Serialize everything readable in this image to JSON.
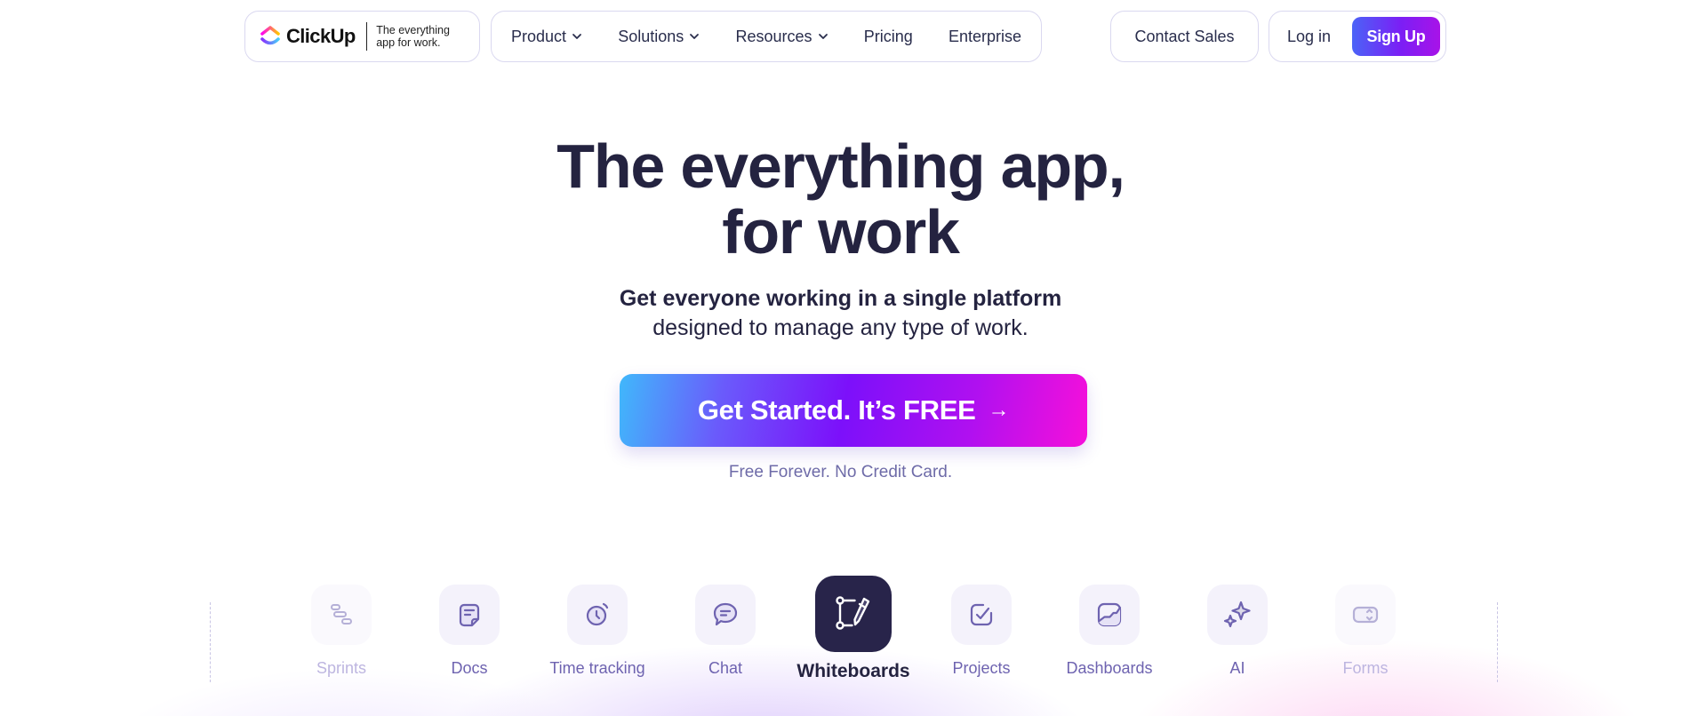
{
  "header": {
    "brand": {
      "name": "ClickUp",
      "tagline_line1": "The everything",
      "tagline_line2": "app for work."
    },
    "nav": [
      {
        "label": "Product",
        "has_dropdown": true
      },
      {
        "label": "Solutions",
        "has_dropdown": true
      },
      {
        "label": "Resources",
        "has_dropdown": true
      },
      {
        "label": "Pricing",
        "has_dropdown": false
      },
      {
        "label": "Enterprise",
        "has_dropdown": false
      }
    ],
    "contact_sales": "Contact Sales",
    "login": "Log in",
    "signup": "Sign Up"
  },
  "hero": {
    "title_line1": "The everything app,",
    "title_line2": "for work",
    "subtitle_bold": "Get everyone working in a single platform",
    "subtitle_regular": "designed to manage any type of work.",
    "cta_label": "Get Started. It’s FREE",
    "cta_arrow": "→",
    "cta_note": "Free Forever. No Credit Card."
  },
  "features": [
    {
      "label": "Sprints",
      "icon": "sprints-icon",
      "state": "faded"
    },
    {
      "label": "Docs",
      "icon": "docs-icon",
      "state": "normal"
    },
    {
      "label": "Time tracking",
      "icon": "time-tracking-icon",
      "state": "normal"
    },
    {
      "label": "Chat",
      "icon": "chat-icon",
      "state": "normal"
    },
    {
      "label": "Whiteboards",
      "icon": "whiteboards-icon",
      "state": "active"
    },
    {
      "label": "Projects",
      "icon": "projects-icon",
      "state": "normal"
    },
    {
      "label": "Dashboards",
      "icon": "dashboards-icon",
      "state": "normal"
    },
    {
      "label": "AI",
      "icon": "ai-icon",
      "state": "normal"
    },
    {
      "label": "Forms",
      "icon": "forms-icon",
      "state": "faded"
    }
  ],
  "colors": {
    "text_dark": "#242340",
    "accent_purple": "#7C10FA",
    "accent_pink": "#F610DA",
    "accent_blue": "#40B8FB",
    "feature_icon": "#6E63B0",
    "active_tile": "#28244A"
  }
}
